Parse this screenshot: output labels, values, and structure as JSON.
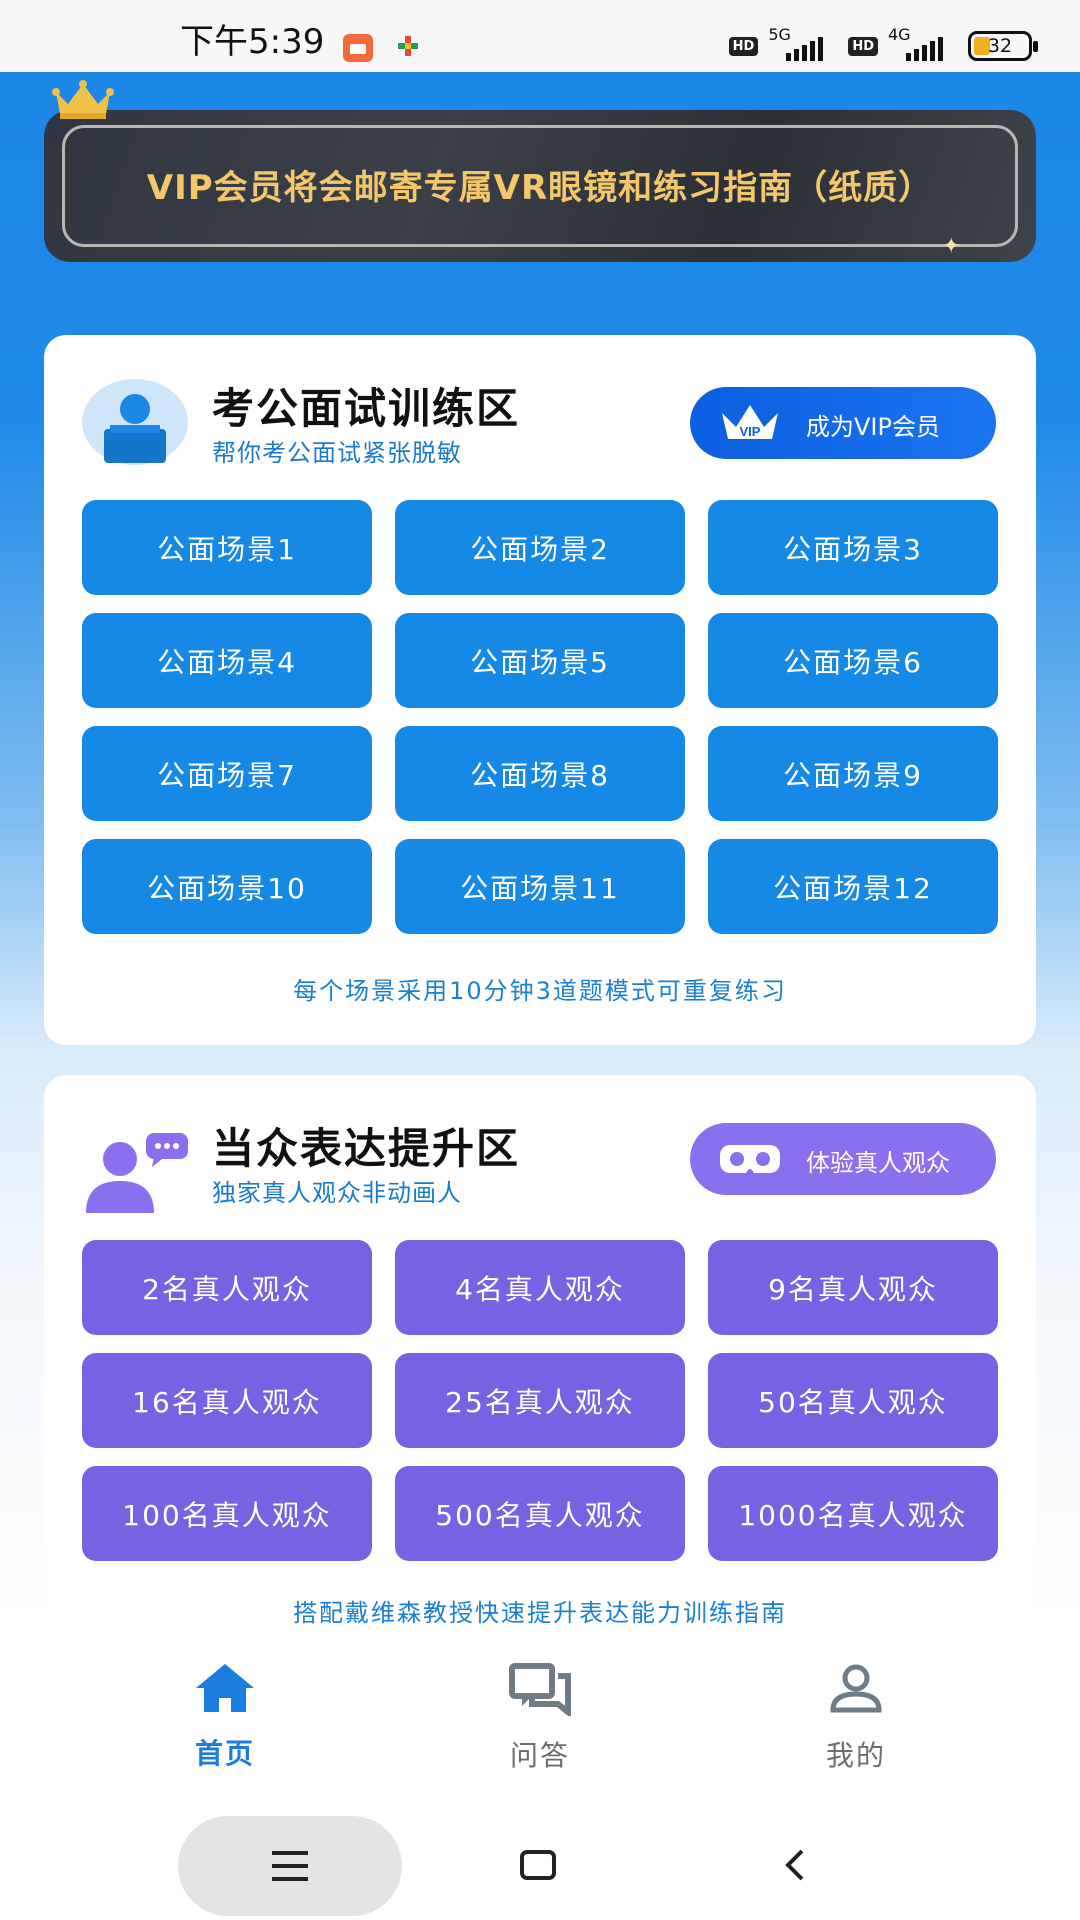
{
  "status_bar": {
    "time": "下午5:39",
    "net1": "5G",
    "net2": "4G",
    "hd": "HD",
    "battery": "32"
  },
  "banner": {
    "text": "VIP会员将会邮寄专属VR眼镜和练习指南（纸质）",
    "icon": "crown-icon"
  },
  "interview_section": {
    "title": "考公面试训练区",
    "subtitle": "帮你考公面试紧张脱敏",
    "vip_button": "成为VIP会员",
    "scenes": [
      "公面场景1",
      "公面场景2",
      "公面场景3",
      "公面场景4",
      "公面场景5",
      "公面场景6",
      "公面场景7",
      "公面场景8",
      "公面场景9",
      "公面场景10",
      "公面场景11",
      "公面场景12"
    ],
    "note": "每个场景采用10分钟3道题模式可重复练习",
    "colors": {
      "button": "#1688e6",
      "vip_pill": "#0c5fe0"
    }
  },
  "speech_section": {
    "title": "当众表达提升区",
    "subtitle": "独家真人观众非动画人",
    "experience_button": "体验真人观众",
    "audiences": [
      "2名真人观众",
      "4名真人观众",
      "9名真人观众",
      "16名真人观众",
      "25名真人观众",
      "50名真人观众",
      "100名真人观众",
      "500名真人观众",
      "1000名真人观众"
    ],
    "note": "搭配戴维森教授快速提升表达能力训练指南",
    "colors": {
      "button": "#7862e3",
      "pill": "#8a70ee"
    }
  },
  "bottom_nav": {
    "items": [
      {
        "label": "首页",
        "icon": "home-icon",
        "active": true
      },
      {
        "label": "问答",
        "icon": "chat-icon",
        "active": false
      },
      {
        "label": "我的",
        "icon": "profile-icon",
        "active": false
      }
    ],
    "active_color": "#1a7ee0"
  }
}
